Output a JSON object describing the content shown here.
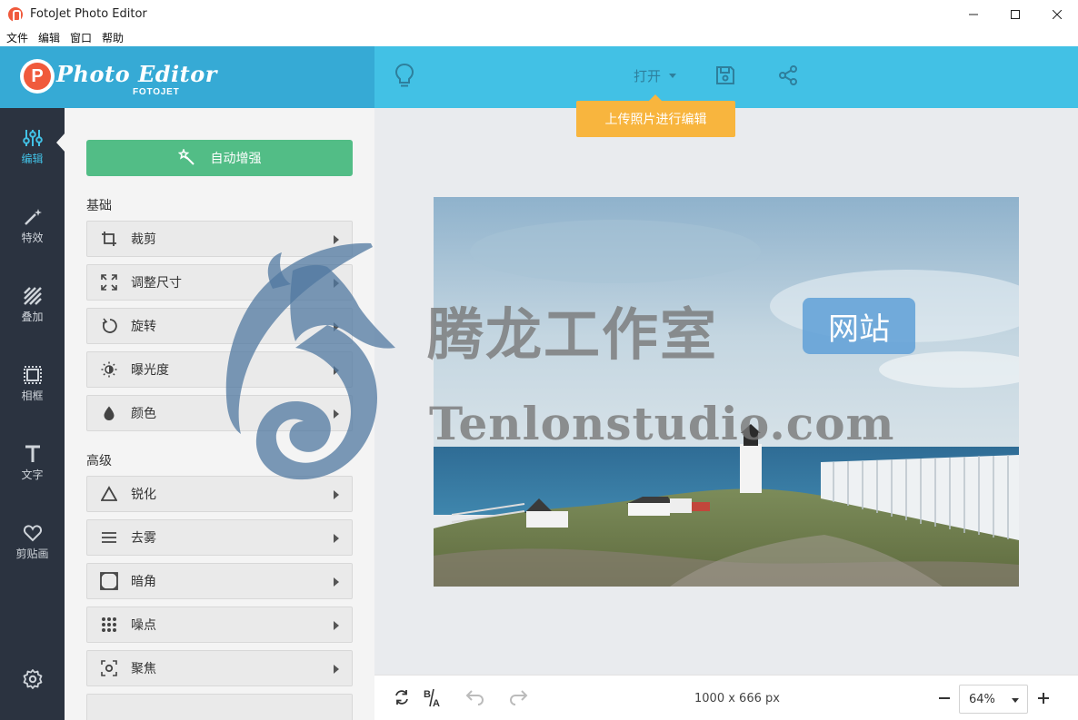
{
  "window": {
    "title": "FotoJet Photo Editor",
    "controls": [
      "minimize-icon",
      "maximize-icon",
      "close-icon"
    ]
  },
  "menu": [
    "文件",
    "编辑",
    "窗口",
    "帮助"
  ],
  "header": {
    "logo_icon_letter": "P",
    "logo_text": "Photo Editor",
    "logo_sub": "FOTOJET",
    "open_label": "打开",
    "tooltip": "上传照片进行编辑",
    "bg_color": "#42c1e5",
    "logo_bg_color": "#36aad5"
  },
  "sidebar": {
    "items": [
      {
        "label": "编辑",
        "icon": "sliders-icon",
        "active": true
      },
      {
        "label": "特效",
        "icon": "magic-wand-icon"
      },
      {
        "label": "叠加",
        "icon": "overlay-stripes-icon"
      },
      {
        "label": "相框",
        "icon": "frame-icon"
      },
      {
        "label": "文字",
        "icon": "text-icon"
      },
      {
        "label": "剪贴画",
        "icon": "heart-icon"
      }
    ],
    "settings_icon": "gear-icon",
    "accent_color": "#42c1e5"
  },
  "panel": {
    "auto_enhance": "自动增强",
    "basic_title": "基础",
    "basic_tools": [
      {
        "label": "裁剪",
        "icon": "crop-icon"
      },
      {
        "label": "调整尺寸",
        "icon": "resize-icon"
      },
      {
        "label": "旋转",
        "icon": "rotate-icon"
      },
      {
        "label": "曝光度",
        "icon": "exposure-icon"
      },
      {
        "label": "颜色",
        "icon": "color-drop-icon"
      }
    ],
    "advanced_title": "高级",
    "advanced_tools": [
      {
        "label": "锐化",
        "icon": "sharpen-triangle-icon"
      },
      {
        "label": "去雾",
        "icon": "dehaze-lines-icon"
      },
      {
        "label": "暗角",
        "icon": "vignette-icon"
      },
      {
        "label": "噪点",
        "icon": "noise-dots-icon"
      },
      {
        "label": "聚焦",
        "icon": "focus-icon"
      }
    ],
    "auto_enhance_color": "#52bd86"
  },
  "watermark": {
    "chinese": "腾龙工作室",
    "badge": "网站",
    "english": "Tenlonstudio.com"
  },
  "bottom": {
    "dimensions": "1000 x 666 px",
    "zoom": "64%"
  }
}
